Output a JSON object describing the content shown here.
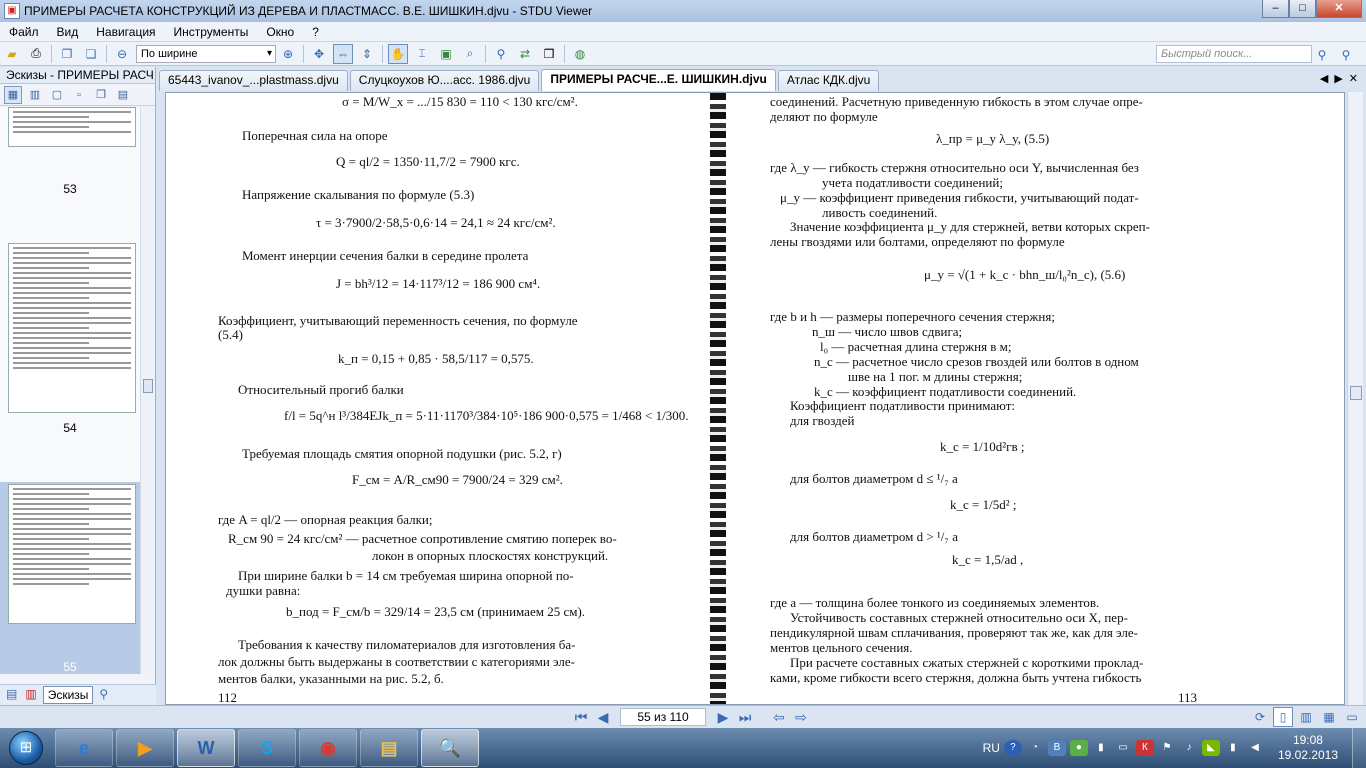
{
  "window": {
    "title": "ПРИМЕРЫ РАСЧЕТА КОНСТРУКЦИЙ ИЗ ДЕРЕВА И ПЛАСТМАСС. В.Е. ШИШКИН.djvu - STDU Viewer",
    "minimize": "–",
    "maximize": "□",
    "close": "✕"
  },
  "menu": [
    "Файл",
    "Вид",
    "Навигация",
    "Инструменты",
    "Окно",
    "?"
  ],
  "toolbar": {
    "zoom": "По ширине",
    "search_placeholder": "Быстрый поиск..."
  },
  "sidebar": {
    "title": "Эскизы - ПРИМЕРЫ РАСЧ",
    "thumb_numbers": [
      "53",
      "54",
      "55"
    ],
    "tabs": [
      "Эскизы"
    ]
  },
  "tabs": [
    "65443_ivanov_...plastmass.djvu",
    "Слуцкоухов Ю....асс. 1986.djvu",
    "ПРИМЕРЫ РАСЧЕ...Е. ШИШКИН.djvu",
    "Атлас КДК.djvu"
  ],
  "left_page": {
    "lines": [
      "σ = M/W_x = .../15 830 = 110 < 130 кгс/см².",
      "Поперечная сила на опоре",
      "Q = ql/2 = 1350·11,7/2 = 7900 кгс.",
      "Напряжение скалывания по формуле (5.3)",
      "τ = 3·7900/2·58,5·0,6·14 = 24,1 ≈ 24 кгс/см².",
      "Момент инерции сечения балки в середине пролета",
      "J = bh³/12 = 14·117³/12 = 186 900 см⁴.",
      "Коэффициент, учитывающий переменность сечения, по формуле",
      "(5.4)",
      "k_п = 0,15 + 0,85 · 58,5/117 = 0,575.",
      "Относительный прогиб балки",
      "f/l = 5q^н l³/384EJk_п = 5·11·1170³/384·10⁵·186 900·0,575 = 1/468 < 1/300.",
      "Требуемая площадь смятия опорной подушки (рис. 5.2, г)",
      "F_см = A/R_см90 = 7900/24 = 329 см².",
      "где        A = ql/2 — опорная реакция балки;",
      "R_см 90 = 24 кгс/см² — расчетное сопротивление смятию поперек во-",
      "локон в опорных плоскостях конструкций.",
      "При ширине балки b = 14 см требуемая ширина опорной по-",
      "душки равна:",
      "b_под = F_см/b = 329/14 = 23,5 см (принимаем 25 см).",
      "Требования к качеству пиломатериалов для изготовления ба-",
      "лок должны быть выдержаны в соответствии с категориями эле-",
      "ментов балки, указанными на рис. 5.2, б.",
      "112"
    ]
  },
  "right_page": {
    "lines": [
      "соединений. Расчетную приведенную гибкость в этом случае опре-",
      "деляют по формуле",
      "λ_пр = μ_y λ_y,                                  (5.5)",
      "где λ_y — гибкость стержня относительно оси Y, вычисленная без",
      "учета податливости соединений;",
      "μ_y — коэффициент приведения гибкости, учитывающий подат-",
      "ливость соединений.",
      "Значение коэффициента μ_y для стержней, ветви которых скреп-",
      "лены гвоздями или болтами, определяют по формуле",
      "μ_y = √(1 + k_c · bhn_ш/l₀²n_c),                  (5.6)",
      "где b и h — размеры поперечного сечения стержня;",
      "n_ш — число швов сдвига;",
      "l₀ — расчетная длина стержня в м;",
      "n_c — расчетное число срезов гвоздей или болтов в одном",
      "шве на 1 пог. м длины стержня;",
      "k_c — коэффициент податливости соединений.",
      "Коэффициент податливости принимают:",
      "для гвоздей",
      "k_c = 1/10d²гв ;",
      "для болтов диаметром   d ≤ ¹/₇ a",
      "k_c = 1/5d² ;",
      "для болтов диаметром   d > ¹/₇ a",
      "k_c = 1,5/ad ,",
      "где a — толщина более тонкого из соединяемых элементов.",
      "Устойчивость составных стержней относительно оси X, пер-",
      "пендикулярной швам сплачивания, проверяют так же, как для эле-",
      "ментов цельного сечения.",
      "При расчете составных сжатых стержней с короткими проклад-",
      "ками, кроме гибкости всего стержня, должна быть учтена гибкость",
      "113"
    ]
  },
  "status": {
    "page_indicator": "55 из 110"
  },
  "taskbar": {
    "apps": [
      "e",
      "▶",
      "W",
      "S",
      "◉",
      "▤",
      "🔍"
    ],
    "lang": "RU",
    "time": "19:08",
    "date": "19.02.2013"
  }
}
